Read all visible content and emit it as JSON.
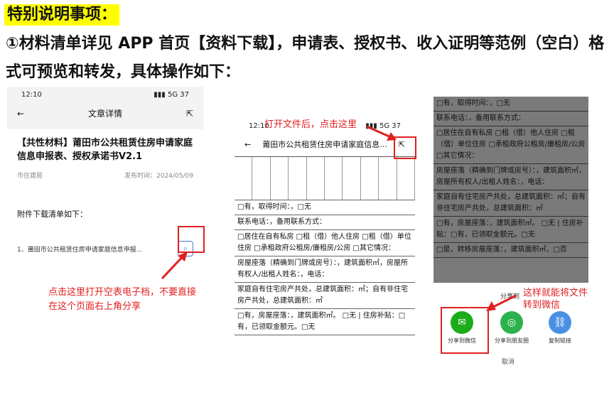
{
  "heading": "特别说明事项：",
  "paragraph": "①材料清单详见 APP 首页【资料下载】，申请表、授权书、收入证明等范例（空白）格式可预览和转发，具体操作如下：",
  "s1": {
    "time": "12:10",
    "signal": "5G",
    "battery": "37",
    "nav_title": "文章详情",
    "article_title": "【共性材料】莆田市公共租赁住房申请家庭信息申报表、授权承诺书V2.1",
    "source": "市住建局",
    "date": "发布时间：2024/05/09",
    "download_heading": "附件下载清单如下：",
    "item": "1、莆田市公共租赁住房申请家庭信息申报...",
    "callout": "点击这里打开空表电子档，不要直接在这个页面右上角分享"
  },
  "s2": {
    "time": "12:10",
    "signal": "5G",
    "battery": "37",
    "callout": "打开文件后，点击这里",
    "nav_title": "莆田市公共租赁住房申请家庭信息...",
    "rows": [
      "□有，取得时间：，□无",
      "联系电话：，备用联系方式：",
      "□居住在自有私房 □租（借）他人住房 □租（借）单位住房 □承租政府公租房/廉租房/公房 □其它情况：",
      "房屋座落（精确到门牌或房号）：，建筑面积㎡，房屋所有权人/出租人姓名：，电话：",
      "家庭自有住宅房产共处，总建筑面积：㎡；自有非住宅房产共处，总建筑面积：㎡",
      "□有，房屋座落：，建筑面积㎡。 □无 | 住房补贴：□有，已领取金额元。□无"
    ]
  },
  "s3": {
    "rows": [
      "□有，取得时间：，□无",
      "联系电话：，备用联系方式：",
      "□居住在自有私房 □租（借）他人住房 □租（借）单位住房 □承租政府公租房/廉租房/公房 □其它情况：",
      "房屋座落（精确到门牌或房号）：，建筑面积㎡，房屋所有权人/出租人姓名：，电话：",
      "家庭自有住宅房产共处，总建筑面积：㎡；自有非住宅房产共处，总建筑面积：㎡",
      "□有，房屋座落：，建筑面积㎡。 □无 | 住房补贴：□有，已领取金额元。□无",
      "□是，转移房屋座落：，建筑面积㎡，□否"
    ],
    "share_label": "分享到",
    "callout": "这样就能将文件转到微信",
    "btn_wechat": "分享到微信",
    "btn_moments": "分享到朋友圈",
    "btn_link": "复制链接",
    "cancel": "取消"
  }
}
